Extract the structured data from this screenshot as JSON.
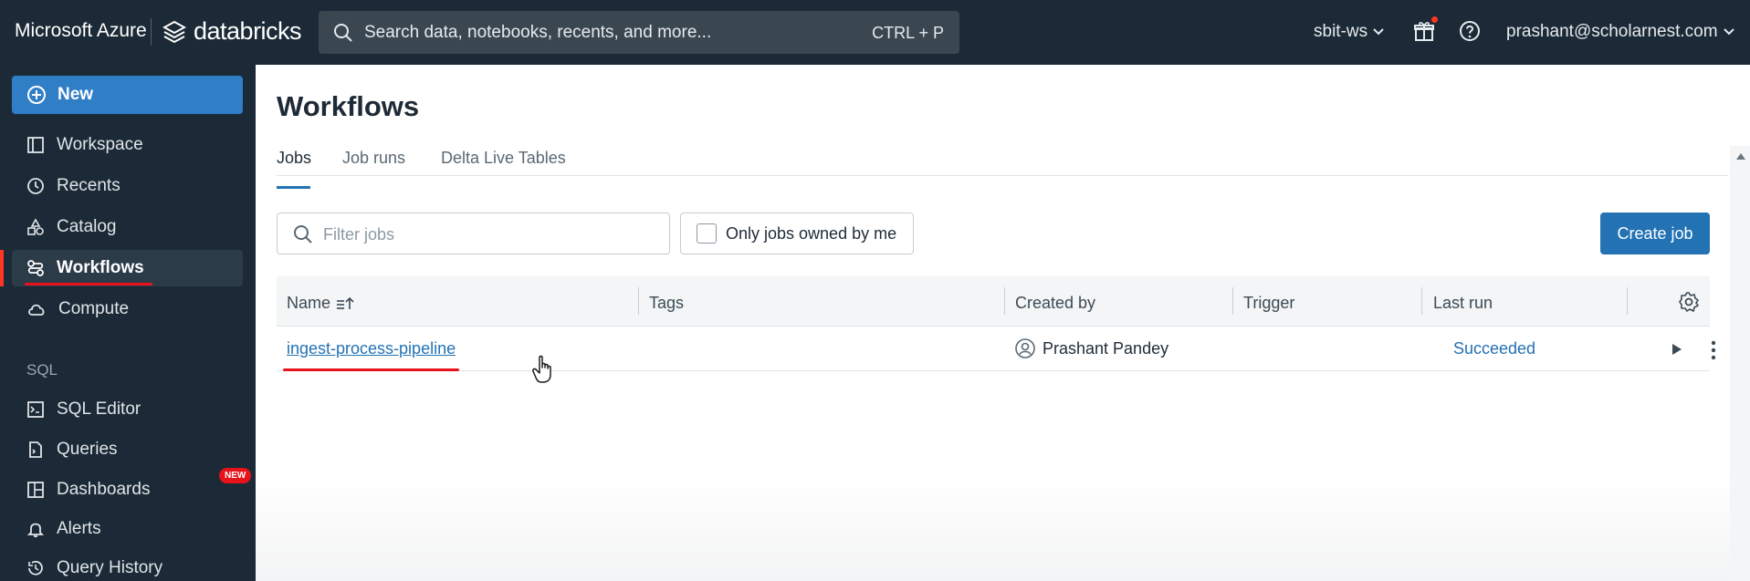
{
  "topbar": {
    "brand_azure": "Microsoft Azure",
    "brand_databricks": "databricks",
    "search_placeholder": "Search data, notebooks, recents, and more...",
    "search_shortcut": "CTRL + P",
    "workspace": "sbit-ws",
    "user_email": "prashant@scholarnest.com"
  },
  "sidebar": {
    "new_label": "New",
    "items": [
      {
        "label": "Workspace",
        "icon": "workspace-icon"
      },
      {
        "label": "Recents",
        "icon": "clock-icon"
      },
      {
        "label": "Catalog",
        "icon": "catalog-icon"
      },
      {
        "label": "Workflows",
        "icon": "workflows-icon",
        "active": true
      },
      {
        "label": "Compute",
        "icon": "cloud-icon"
      }
    ],
    "sql_section": "SQL",
    "sql_items": [
      {
        "label": "SQL Editor",
        "icon": "sql-editor-icon"
      },
      {
        "label": "Queries",
        "icon": "queries-icon"
      },
      {
        "label": "Dashboards",
        "icon": "dashboards-icon",
        "badge": "NEW"
      },
      {
        "label": "Alerts",
        "icon": "bell-icon"
      },
      {
        "label": "Query History",
        "icon": "history-icon"
      }
    ]
  },
  "main": {
    "title": "Workflows",
    "tabs": [
      {
        "label": "Jobs",
        "active": true
      },
      {
        "label": "Job runs"
      },
      {
        "label": "Delta Live Tables"
      }
    ],
    "filter_placeholder": "Filter jobs",
    "only_mine_label": "Only jobs owned by me",
    "create_job_label": "Create job",
    "table": {
      "columns": [
        "Name",
        "Tags",
        "Created by",
        "Trigger",
        "Last run"
      ],
      "rows": [
        {
          "name": "ingest-process-pipeline",
          "tags": "",
          "created_by": "Prashant Pandey",
          "trigger": "",
          "last_run": "Succeeded"
        }
      ]
    }
  },
  "colors": {
    "topbar_bg": "#1b2a36",
    "accent_blue": "#2272b4",
    "new_button": "#2f7ec6",
    "annotation_red": "#e8121b"
  }
}
